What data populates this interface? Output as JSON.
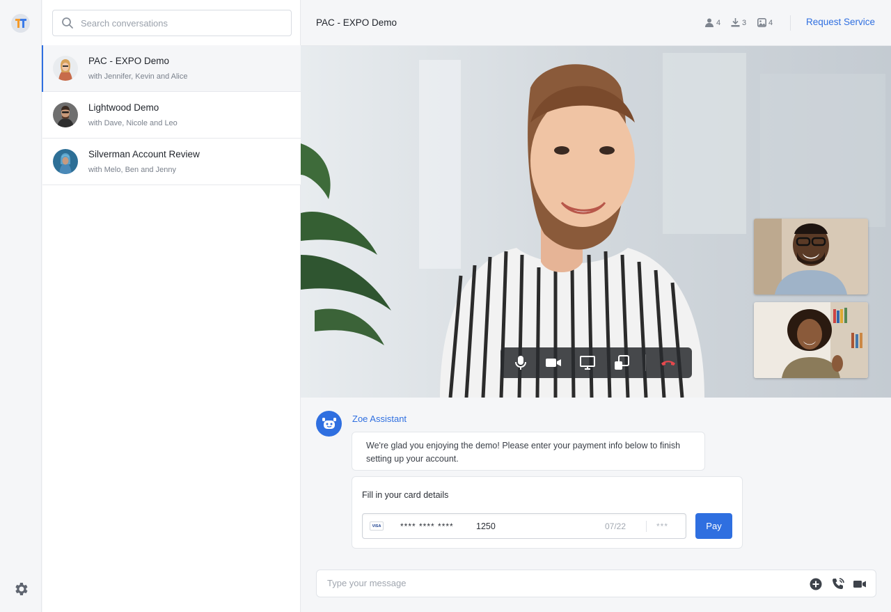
{
  "app": {
    "logo_letter": "T",
    "brand_colors": {
      "accent": "#2f6fe0",
      "logo_left": "#f39a2b",
      "logo_right": "#3b7be8"
    }
  },
  "search": {
    "placeholder": "Search conversations"
  },
  "conversations": [
    {
      "title": "PAC - EXPO Demo",
      "subtitle": "with Jennifer, Kevin and Alice",
      "active": true
    },
    {
      "title": "Lightwood Demo",
      "subtitle": "with Dave, Nicole and Leo",
      "active": false
    },
    {
      "title": "Silverman Account Review",
      "subtitle": "with Melo, Ben and Jenny",
      "active": false
    }
  ],
  "header": {
    "title": "PAC - EXPO Demo",
    "stats": [
      {
        "icon": "person-icon",
        "count": "4"
      },
      {
        "icon": "download-icon",
        "count": "3"
      },
      {
        "icon": "image-icon",
        "count": "4"
      }
    ],
    "request_label": "Request Service"
  },
  "call_controls": [
    "microphone-icon",
    "camera-icon",
    "screen-share-icon",
    "switch-view-icon",
    "end-call-icon"
  ],
  "chat": {
    "bot_name": "Zoe Assistant",
    "message": "We're glad you enjoying the demo! Please enter your payment info below to finish setting up your account.",
    "card": {
      "label": "Fill in your card details",
      "brand": "VISA",
      "masked": "**** **** ****",
      "last4": "1250",
      "expiry": "07/22",
      "cvc": "***",
      "pay_label": "Pay"
    }
  },
  "composer": {
    "placeholder": "Type your message"
  }
}
